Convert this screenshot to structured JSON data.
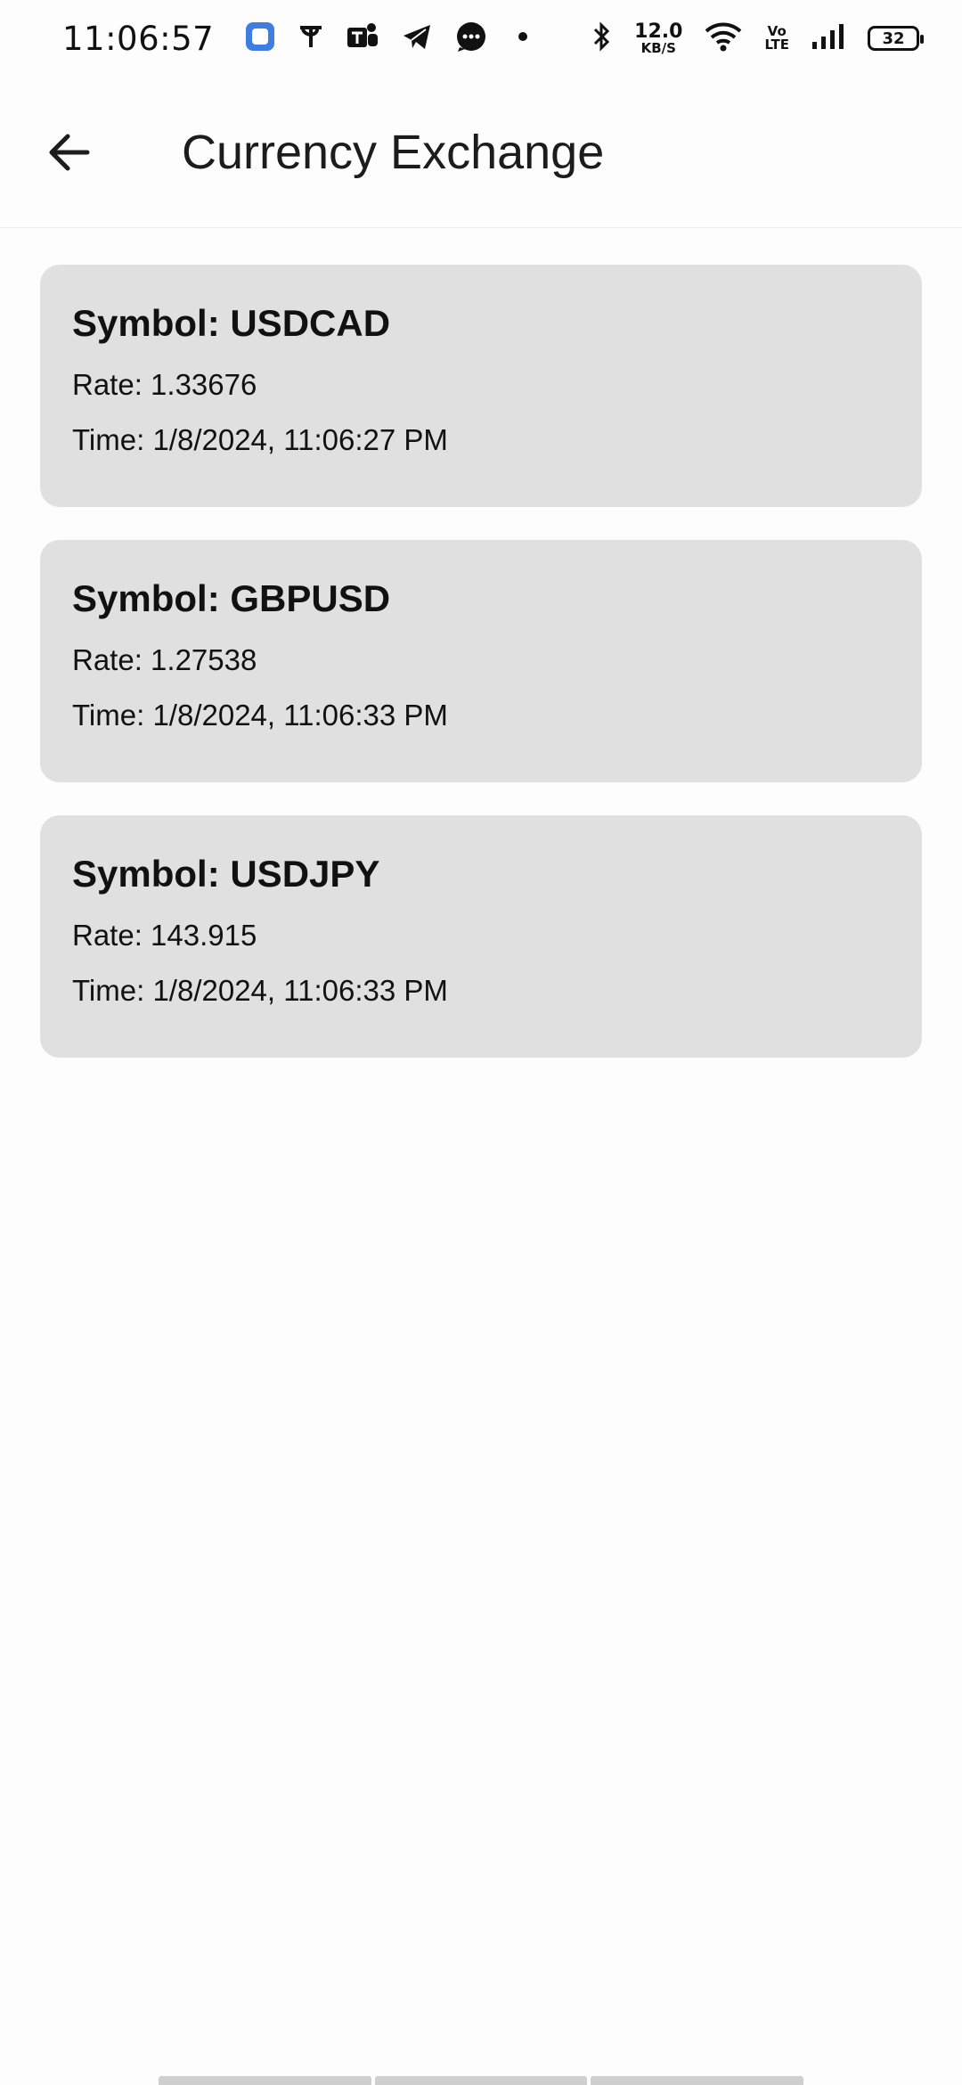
{
  "status_bar": {
    "time": "11:06:57",
    "net_speed_value": "12.0",
    "net_speed_unit": "KB/S",
    "volte_top": "Vo",
    "volte_bottom": "LTE",
    "battery": "32"
  },
  "app_bar": {
    "title": "Currency Exchange"
  },
  "rates": [
    {
      "symbol": "Symbol: USDCAD",
      "rate": "Rate: 1.33676",
      "time": "Time: 1/8/2024, 11:06:27 PM"
    },
    {
      "symbol": "Symbol: GBPUSD",
      "rate": "Rate: 1.27538",
      "time": "Time: 1/8/2024, 11:06:33 PM"
    },
    {
      "symbol": "Symbol: USDJPY",
      "rate": "Rate: 143.915",
      "time": "Time: 1/8/2024, 11:06:33 PM"
    }
  ]
}
